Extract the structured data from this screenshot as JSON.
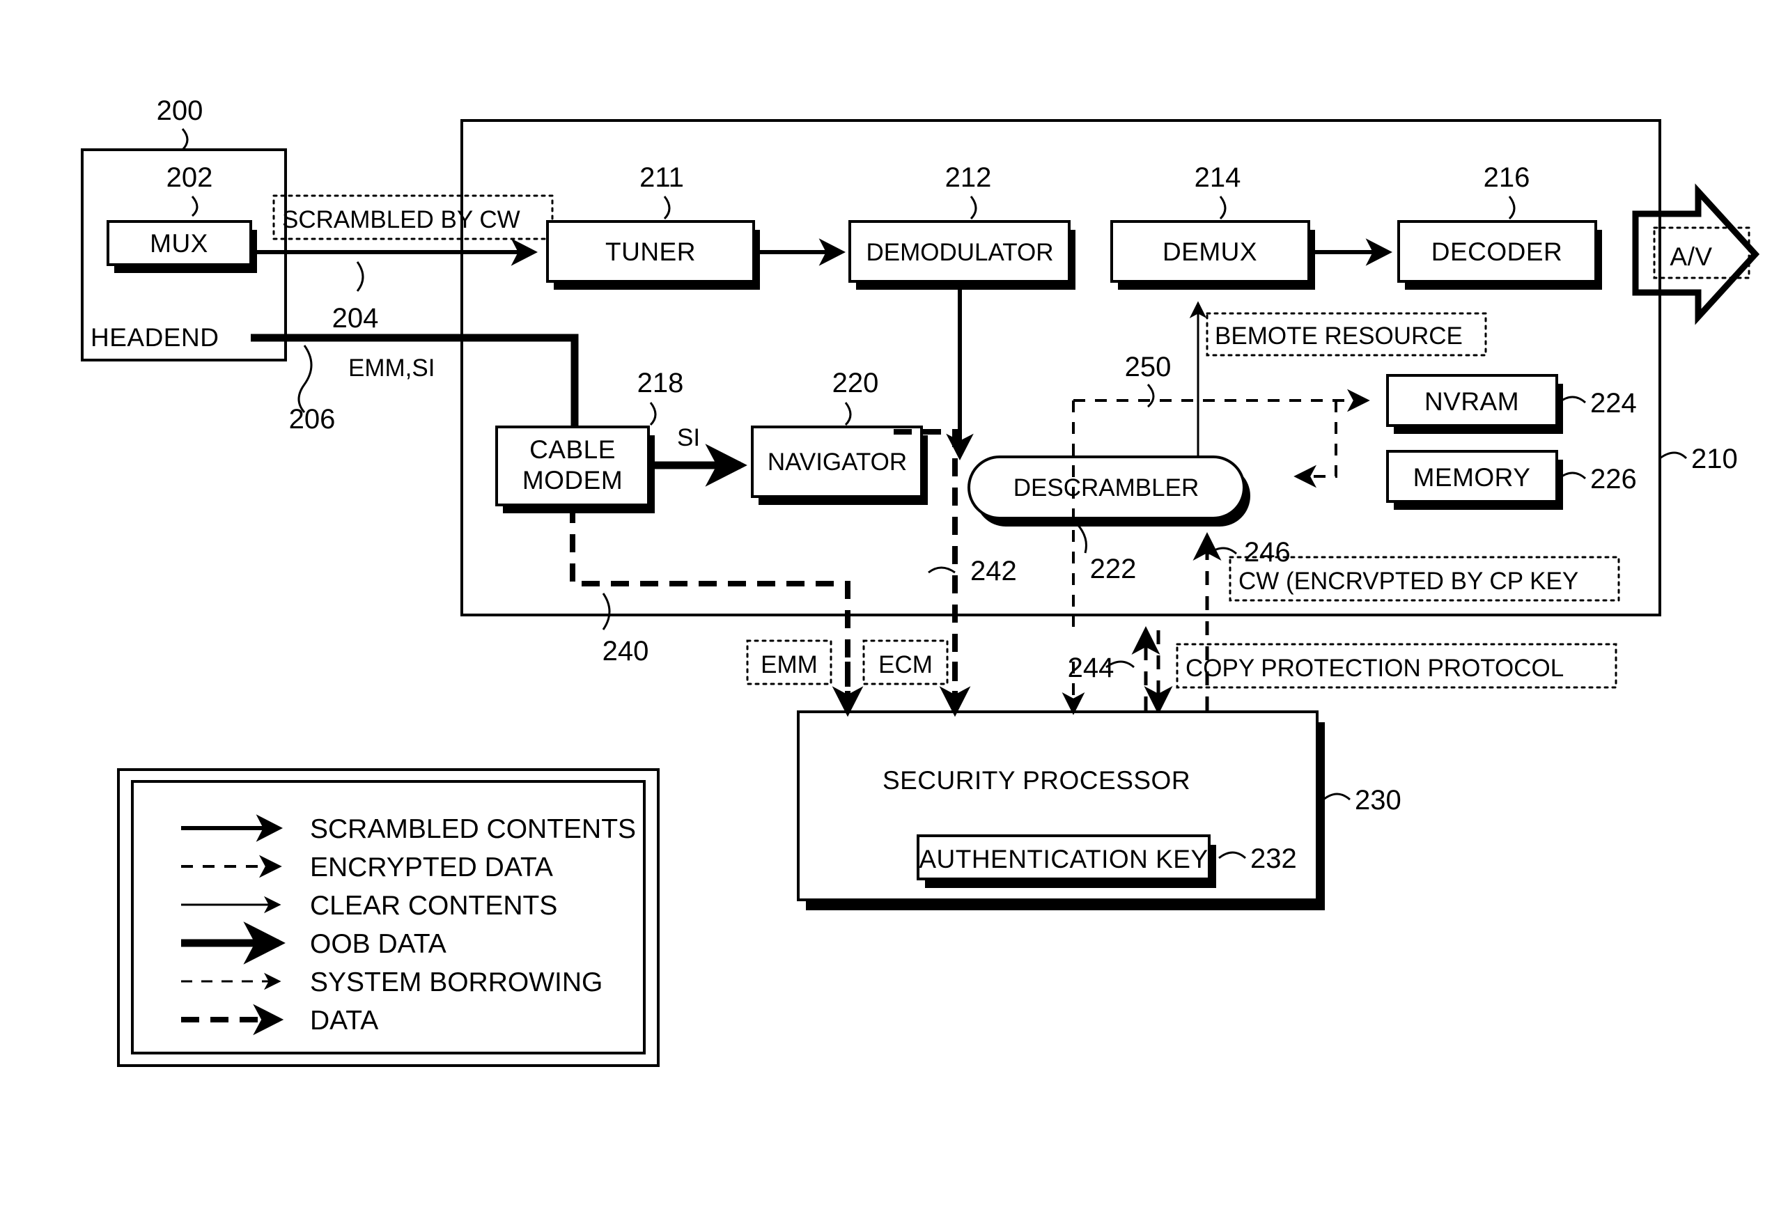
{
  "figure": {
    "blocks": [
      {
        "id": "headend",
        "label": "HEADEND",
        "ref": "200"
      },
      {
        "id": "mux",
        "label": "MUX",
        "ref": "202"
      },
      {
        "id": "tuner",
        "label": "TUNER",
        "ref": "211"
      },
      {
        "id": "demodulator",
        "label": "DEMODULATOR",
        "ref": "212"
      },
      {
        "id": "demux",
        "label": "DEMUX",
        "ref": "214"
      },
      {
        "id": "decoder",
        "label": "DECODER",
        "ref": "216"
      },
      {
        "id": "cable_modem",
        "label_line1": "CABLE",
        "label_line2": "MODEM",
        "ref": "218"
      },
      {
        "id": "navigator",
        "label": "NAVIGATOR",
        "ref": "220"
      },
      {
        "id": "descrambler",
        "label": "DESCRAMBLER",
        "ref": "222"
      },
      {
        "id": "nvram",
        "label": "NVRAM",
        "ref": "224"
      },
      {
        "id": "memory",
        "label": "MEMORY",
        "ref": "226"
      },
      {
        "id": "security_processor",
        "label": "SECURITY PROCESSOR",
        "ref": "230"
      },
      {
        "id": "authentication_key",
        "label": "AUTHENTICATION KEY",
        "ref": "232"
      },
      {
        "id": "av_output",
        "label": "A/V"
      },
      {
        "id": "host_device",
        "ref": "210"
      }
    ],
    "annotations": {
      "scrambled_by_cw": "SCRAMBLED BY CW",
      "emm_si": "EMM,SI",
      "si": "SI",
      "remote_resource": "BEMOTE RESOURCE",
      "cw_encrypted": "CW (ENCRVPTED BY CP KEY",
      "copy_protection": "COPY PROTECTION PROTOCOL",
      "emm": "EMM",
      "ecm": "ECM",
      "av": "A/V"
    },
    "ref_numbers": {
      "headend": "200",
      "mux": "202",
      "scrambled_line": "204",
      "emm_si_line": "206",
      "host": "210",
      "tuner": "211",
      "demodulator": "212",
      "demux": "214",
      "decoder": "216",
      "cable_modem": "218",
      "navigator": "220",
      "descrambler": "222",
      "nvram": "224",
      "memory": "226",
      "security_processor": "230",
      "auth_key": "232",
      "oob_data_line": "240",
      "ecm_line": "242",
      "cp_line": "244",
      "cw_line": "246",
      "borrow_line": "250"
    },
    "legend": {
      "items": [
        {
          "style": "scrambled",
          "label": "SCRAMBLED CONTENTS"
        },
        {
          "style": "encrypted",
          "label": "ENCRYPTED DATA"
        },
        {
          "style": "clear",
          "label": "CLEAR CONTENTS"
        },
        {
          "style": "oob",
          "label": "OOB DATA"
        },
        {
          "style": "borrowing",
          "label": "SYSTEM BORROWING"
        },
        {
          "style": "data",
          "label": "DATA"
        }
      ]
    }
  }
}
